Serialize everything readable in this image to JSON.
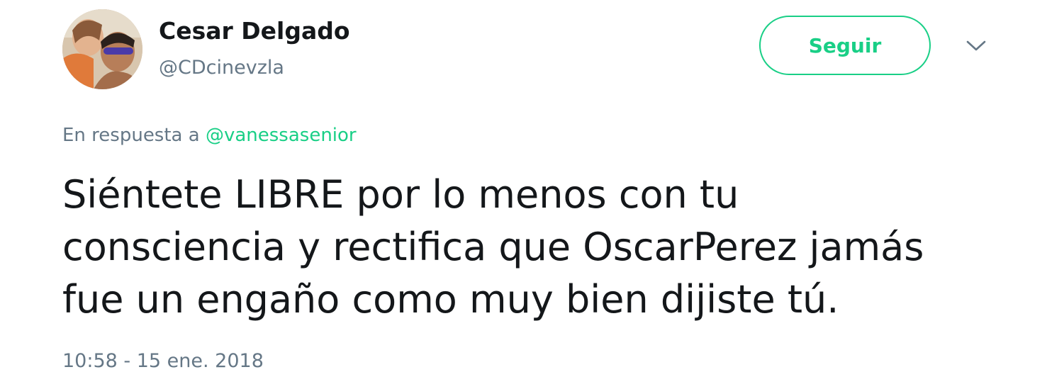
{
  "user": {
    "name": "Cesar Delgado",
    "handle": "@CDcinevzla"
  },
  "follow_button": {
    "label": "Seguir"
  },
  "menu": {
    "icon": "chevron-down-icon"
  },
  "reply": {
    "prefix": "En respuesta a",
    "mention": "@vanessasenior"
  },
  "tweet": {
    "lines": [
      "Siéntete LIBRE por lo menos con tu",
      "consciencia y rectifica que OscarPerez jamás",
      "fue un engaño como muy bien dijiste tú."
    ],
    "timestamp": "10:58 - 15 ene. 2018"
  },
  "colors": {
    "accent": "#19cf86",
    "secondary_text": "#657786",
    "primary_text": "#14171a"
  }
}
